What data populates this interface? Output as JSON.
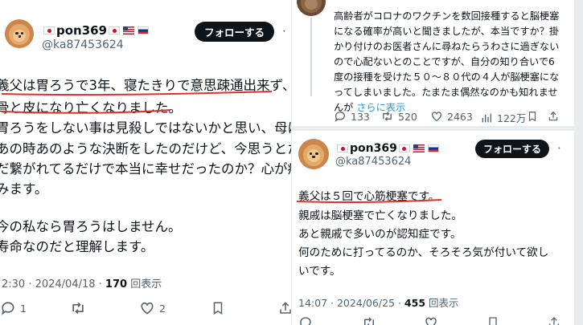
{
  "left_post": {
    "display_name": "pon369",
    "handle": "@ka87453624",
    "follow_label": "フォローする",
    "more_label": "…",
    "lines": [
      "義父は胃ろうで3年、寝たきりで意思疎通出来ず、",
      "骨と皮になり亡くなりました。",
      "胃ろうをしない事は見殺しではないかと思い、母は",
      "あの時あのような決断をしたのだけど、今思うとた",
      "だ繋がれてるだけで本当に幸せだったのか？心が痛",
      "みます。",
      "",
      "今の私なら胃ろうはしません。",
      "寿命なのだと理解します。"
    ],
    "time": "2:30 · 2024/04/18 · ",
    "views_count": "170",
    "views_label": " 回表示",
    "actions": {
      "replies": "1",
      "reposts": "",
      "likes": "2"
    }
  },
  "right_top_post": {
    "lines": [
      "高齢者がコロナのワクチンを数回接種すると脳梗塞",
      "になる確率が高いと聞きましたが、本当ですか？掛",
      "かり付けのお医者さんに尋ねたらうわさに過ぎない",
      "ので心配ないとのことですが、自分の知り合いで6",
      "度の接種を受けた５０〜８０代の４人が脳梗塞にな",
      "ってしまいました。たまたま偶然なのかも知れませ",
      "んが "
    ],
    "show_more": "さらに表示",
    "actions": {
      "replies": "133",
      "reposts": "520",
      "likes": "2463",
      "views": "122万"
    }
  },
  "right_bottom_post": {
    "display_name": "pon369",
    "handle": "@ka87453624",
    "follow_label": "フォローする",
    "lines": [
      "義父は５回で心筋梗塞です。",
      "親戚は脳梗塞で亡くなりました。",
      "あと親戚で多いのが認知症です。",
      "何のために打ってるのか、そろそろ気が付いて欲し",
      "いです。"
    ],
    "time": "14:07 · 2024/06/25 · ",
    "views_count": "455",
    "views_label": " 回表示"
  },
  "colors": {
    "accent": "#1d9bf0",
    "underline": "#e0302b",
    "text": "#0f1419",
    "muted": "#536471"
  }
}
